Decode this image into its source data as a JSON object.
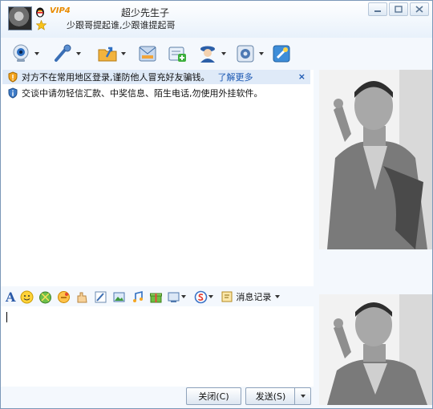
{
  "title": {
    "vip_label": "VIP4",
    "name_fragment": "超少先生子",
    "signature": "少跟哥提起谁,少跟谁提起哥"
  },
  "toolbar": {
    "items": [
      {
        "icon": "webcam-icon"
      },
      {
        "icon": "microphone-icon"
      },
      {
        "icon": "send-file-icon"
      },
      {
        "icon": "send-sms-icon"
      },
      {
        "icon": "create-group-icon"
      },
      {
        "icon": "remote-assist-icon"
      },
      {
        "icon": "app-settings-icon"
      },
      {
        "icon": "share-icon"
      }
    ]
  },
  "chat": {
    "notice1": {
      "text": "对方不在常用地区登录,谨防他人冒充好友骗钱。",
      "link": "了解更多",
      "close": "×"
    },
    "notice2": {
      "text": "交谈中请勿轻信汇款、中奖信息、陌生电话,勿使用外挂软件。"
    }
  },
  "format_toolbar": {
    "font_label": "A",
    "history_label": "消息记录"
  },
  "buttons": {
    "close": "关闭(C)",
    "send": "发送(S)"
  },
  "colors": {
    "accent": "#1a57b2",
    "vip": "#e98b00",
    "notice_bg": "#dfeaf8"
  }
}
